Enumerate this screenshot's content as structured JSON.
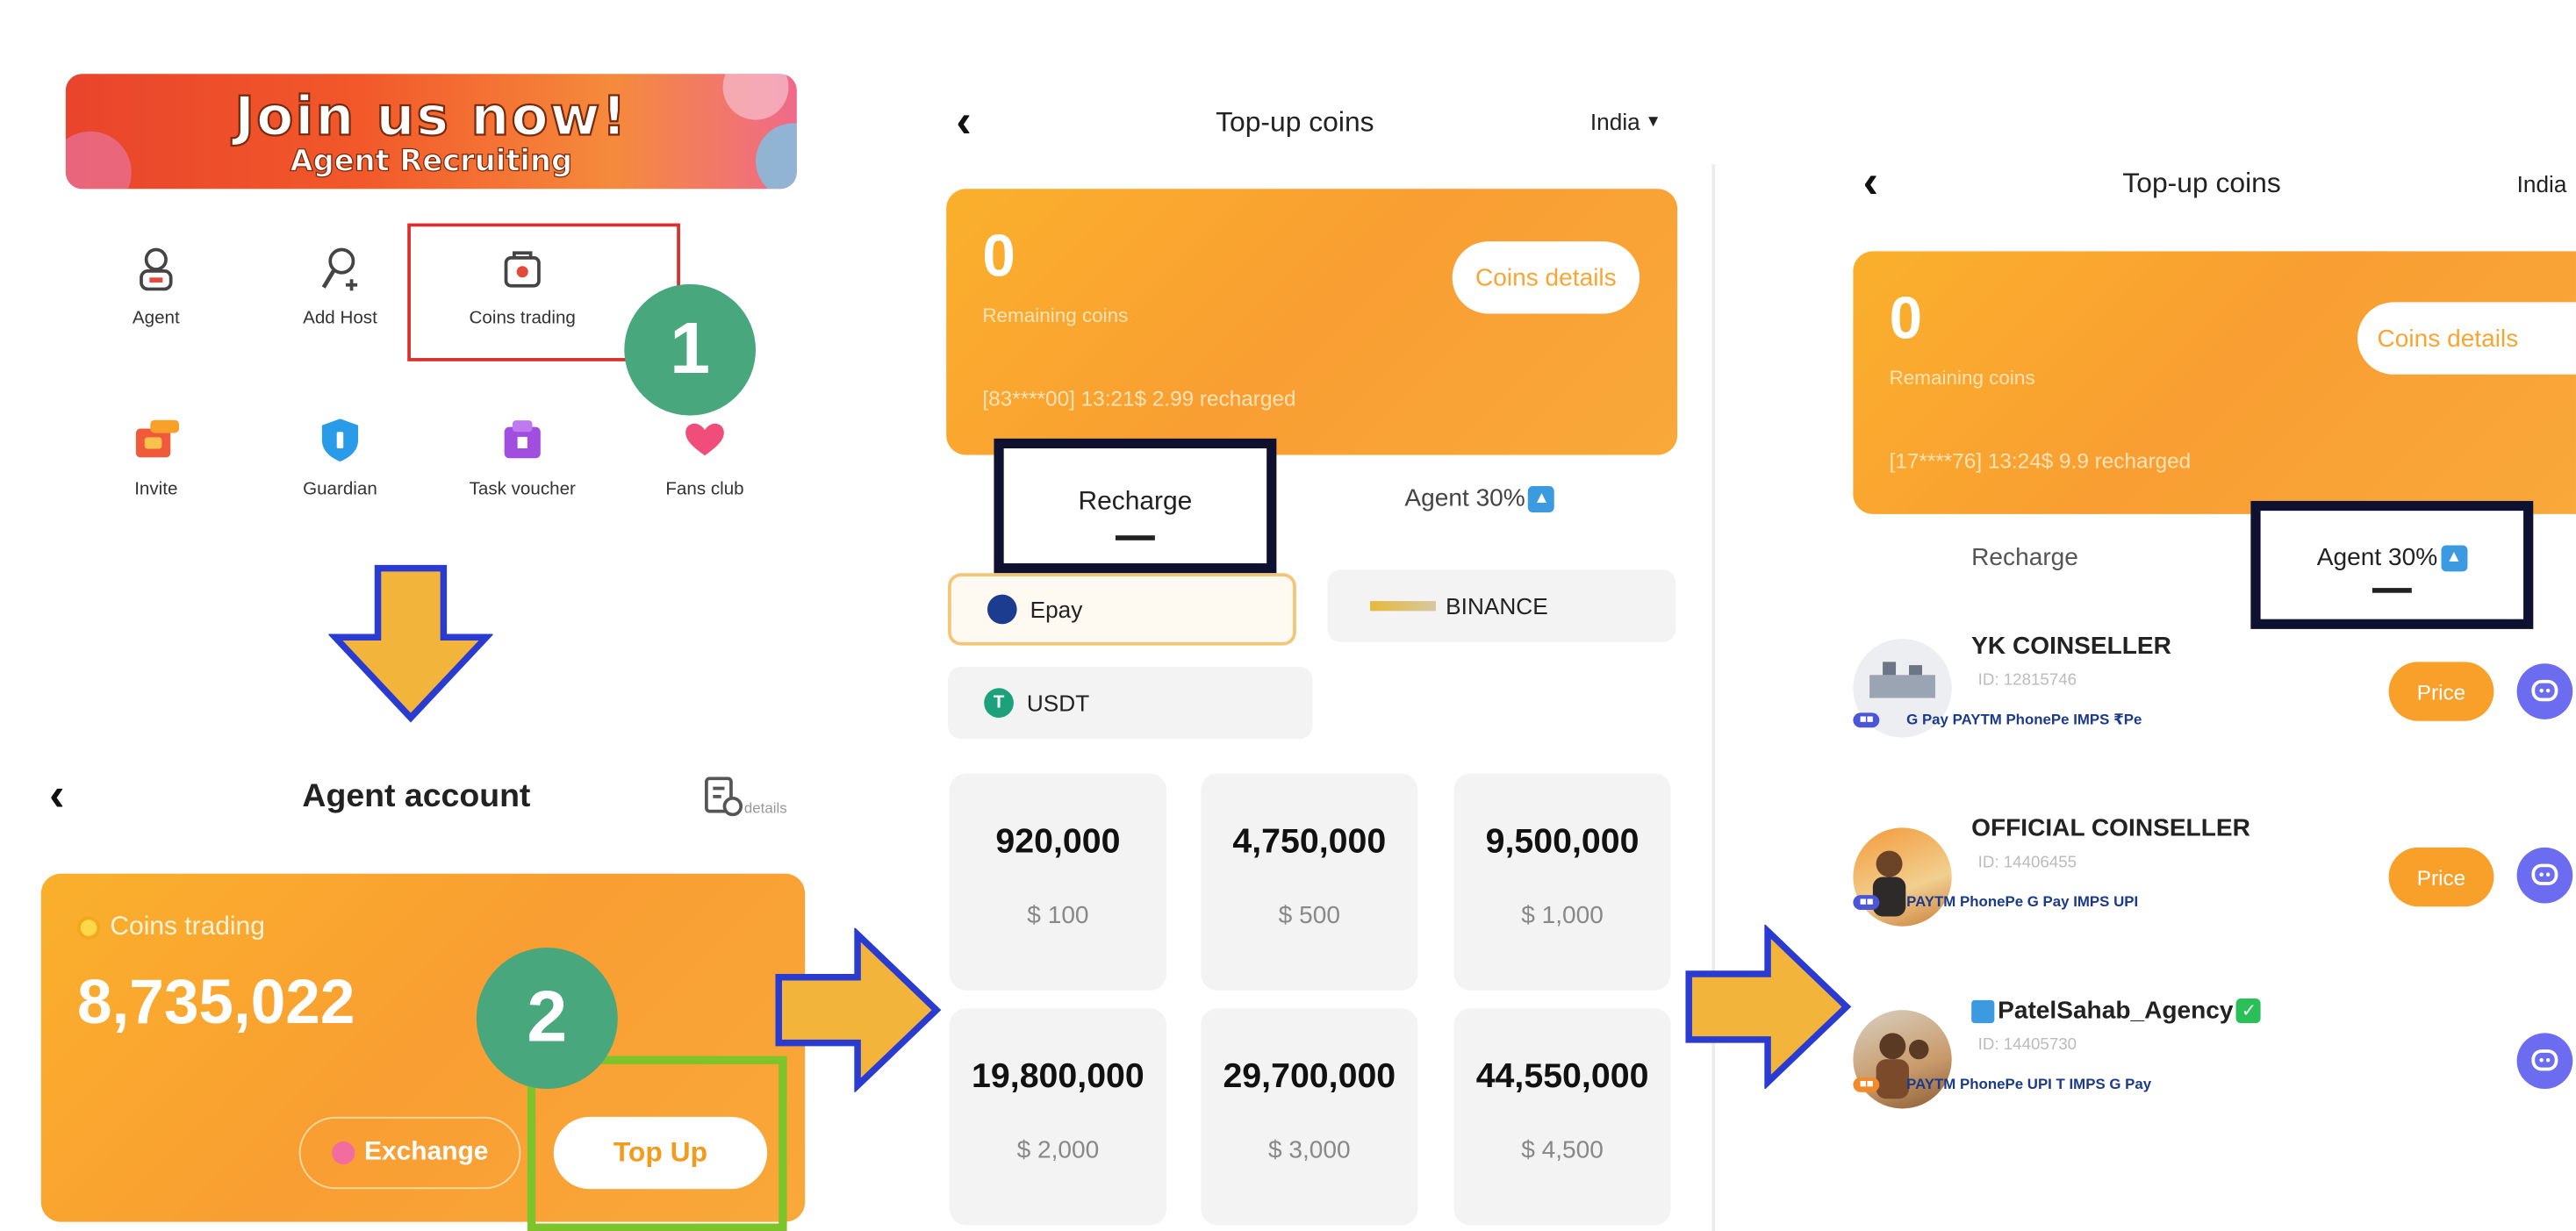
{
  "panel1": {
    "banner": {
      "line1": "Join us now!",
      "line2": "Agent Recruiting"
    },
    "grid": [
      {
        "label": "Agent",
        "icon": "agent-icon"
      },
      {
        "label": "Add Host",
        "icon": "add-host-icon"
      },
      {
        "label": "Coins trading",
        "icon": "coins-trading-icon"
      },
      {
        "label": "Invite",
        "icon": "invite-icon"
      },
      {
        "label": "Guardian",
        "icon": "guardian-icon"
      },
      {
        "label": "Task voucher",
        "icon": "task-voucher-icon"
      },
      {
        "label": "Fans club",
        "icon": "fans-club-icon"
      }
    ],
    "step1": "1"
  },
  "panel2": {
    "title": "Agent account",
    "details": "details",
    "card_label": "Coins trading",
    "balance": "8,735,022",
    "exchange": "Exchange",
    "topup": "Top Up",
    "step2": "2"
  },
  "panel3": {
    "title": "Top-up coins",
    "region": "India",
    "remaining": "0",
    "remaining_label": "Remaining coins",
    "coins_details": "Coins details",
    "recharge_note": "[83****00] 13:21$ 2.99 recharged",
    "tab_recharge": "Recharge",
    "tab_agent": "Agent 30%",
    "pay": [
      "Epay",
      "BINANCE",
      "USDT"
    ],
    "packages": [
      {
        "coins": "920,000",
        "price": "$ 100"
      },
      {
        "coins": "4,750,000",
        "price": "$ 500"
      },
      {
        "coins": "9,500,000",
        "price": "$ 1,000"
      },
      {
        "coins": "19,800,000",
        "price": "$ 2,000"
      },
      {
        "coins": "29,700,000",
        "price": "$ 3,000"
      },
      {
        "coins": "44,550,000",
        "price": "$ 4,500"
      }
    ]
  },
  "panel4": {
    "title": "Top-up coins",
    "region": "India",
    "remaining": "0",
    "remaining_label": "Remaining coins",
    "coins_details": "Coins details",
    "recharge_note": "[17****76] 13:24$ 9.9 recharged",
    "tab_recharge": "Recharge",
    "tab_agent": "Agent 30%",
    "sellers": [
      {
        "name": "YK COINSELLER",
        "id": "ID: 12815746",
        "price": "Price",
        "logos": "G Pay  PAYTM  PhonePe  IMPS  ₹Pe"
      },
      {
        "name": "OFFICIAL COINSELLER",
        "id": "ID: 14406455",
        "price": "Price",
        "logos": "PAYTM  PhonePe  G Pay  IMPS  UPI"
      },
      {
        "name": "PatelSahab_Agency",
        "id": "ID: 14405730",
        "price": "",
        "logos": "PAYTM  PhonePe  UPI  T  IMPS  G Pay"
      }
    ]
  },
  "colors": {
    "orange": "#f9a532",
    "green_step": "#48a77d",
    "arrow_fill": "#f3b43b",
    "arrow_stroke": "#2a3bd1",
    "highlight_green": "#7cc42a",
    "navy_box": "#0f1130"
  }
}
